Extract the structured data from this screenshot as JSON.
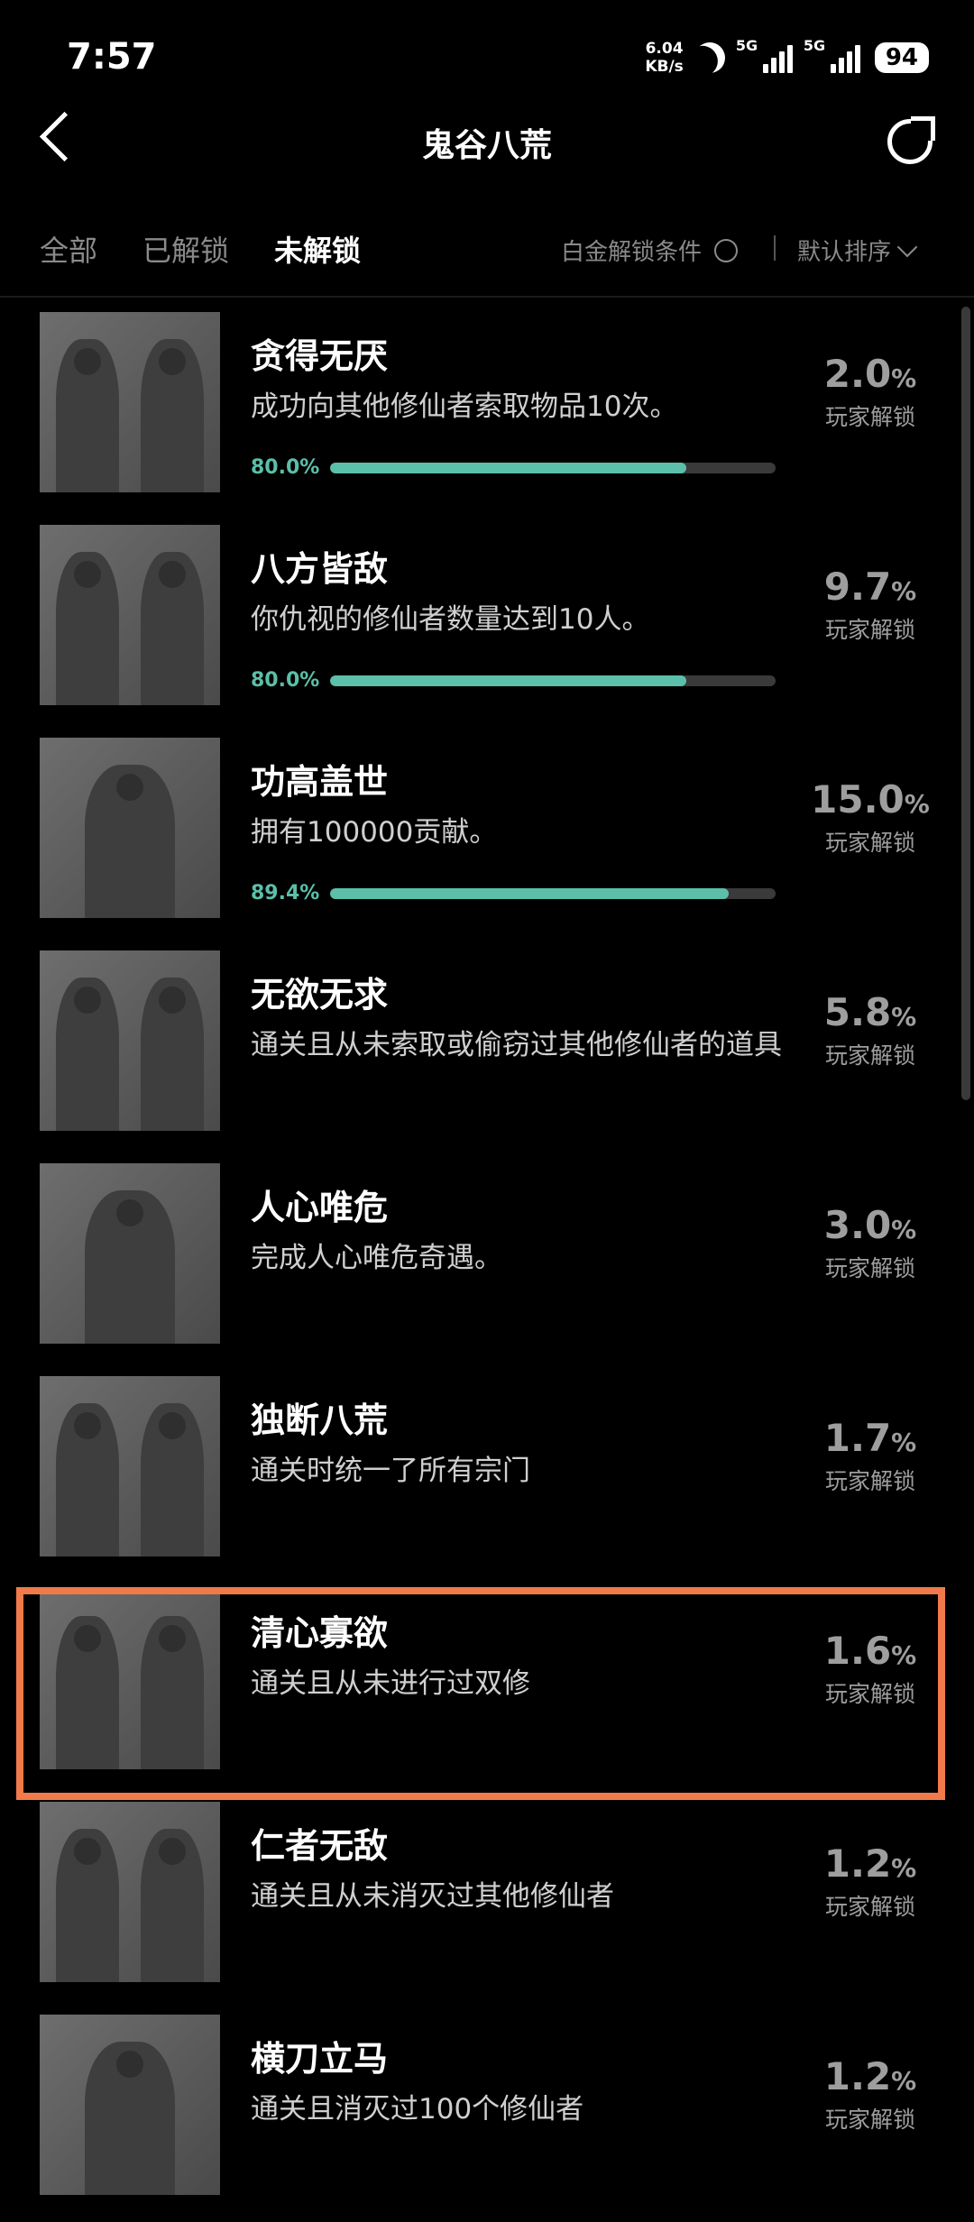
{
  "status": {
    "time": "7:57",
    "speed_value": "6.04",
    "speed_unit": "KB/s",
    "net1": "5G",
    "net2": "5G",
    "battery": "94"
  },
  "header": {
    "title": "鬼谷八荒",
    "back_icon": "back-arrow-icon",
    "share_icon": "share-icon"
  },
  "tabs": [
    {
      "label": "全部"
    },
    {
      "label": "已解锁"
    },
    {
      "label": "未解锁",
      "active": true
    }
  ],
  "filter": {
    "label": "白金解锁条件"
  },
  "sort": {
    "label": "默认排序"
  },
  "colors": {
    "accent": "#5bbfa9",
    "highlight": "#f07a4a"
  },
  "items": [
    {
      "name": "贪得无厌",
      "desc": "成功向其他修仙者索取物品10次。",
      "pct": "2.0",
      "pct_sym": "%",
      "unlock": "玩家解锁",
      "progress_text": "80.0%",
      "progress": 0.8
    },
    {
      "name": "八方皆敌",
      "desc": "你仇视的修仙者数量达到10人。",
      "pct": "9.7",
      "pct_sym": "%",
      "unlock": "玩家解锁",
      "progress_text": "80.0%",
      "progress": 0.8
    },
    {
      "name": "功高盖世",
      "desc": "拥有100000贡献。",
      "pct": "15.0",
      "pct_sym": "%",
      "unlock": "玩家解锁",
      "progress_text": "89.4%",
      "progress": 0.894
    },
    {
      "name": "无欲无求",
      "desc": "通关且从未索取或偷窃过其他修仙者的道具",
      "pct": "5.8",
      "pct_sym": "%",
      "unlock": "玩家解锁"
    },
    {
      "name": "人心唯危",
      "desc": "完成人心唯危奇遇。",
      "pct": "3.0",
      "pct_sym": "%",
      "unlock": "玩家解锁"
    },
    {
      "name": "独断八荒",
      "desc": "通关时统一了所有宗门",
      "pct": "1.7",
      "pct_sym": "%",
      "unlock": "玩家解锁"
    },
    {
      "name": "清心寡欲",
      "desc": "通关且从未进行过双修",
      "pct": "1.6",
      "pct_sym": "%",
      "unlock": "玩家解锁"
    },
    {
      "name": "仁者无敌",
      "desc": "通关且从未消灭过其他修仙者",
      "pct": "1.2",
      "pct_sym": "%",
      "unlock": "玩家解锁"
    },
    {
      "name": "横刀立马",
      "desc": "通关且消灭过100个修仙者",
      "pct": "1.2",
      "pct_sym": "%",
      "unlock": "玩家解锁"
    }
  ]
}
